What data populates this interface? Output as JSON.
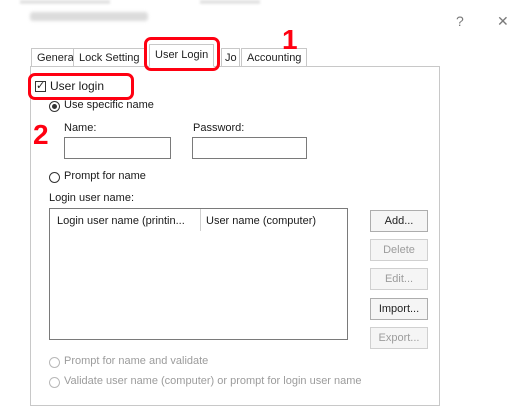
{
  "window": {
    "help_icon": "?",
    "close_icon": "✕"
  },
  "tabs": [
    {
      "label": "General"
    },
    {
      "label": "Lock Setting"
    },
    {
      "label": "User Login"
    },
    {
      "label": "Jo"
    },
    {
      "label": "Accounting"
    }
  ],
  "callouts": {
    "one": "1",
    "two": "2"
  },
  "user_login_checkbox": {
    "label": "User login",
    "checked": true
  },
  "use_specific_name": {
    "label": "Use specific name"
  },
  "name_label": "Name:",
  "password_label": "Password:",
  "prompt_for_name": {
    "label": "Prompt for name"
  },
  "login_user_name_label": "Login user name:",
  "list_columns": [
    "Login user name (printin...",
    "User name (computer)"
  ],
  "buttons": {
    "add": "Add...",
    "delete": "Delete",
    "edit": "Edit...",
    "import": "Import...",
    "export": "Export..."
  },
  "prompt_validate": {
    "label": "Prompt for name and validate"
  },
  "validate_user": {
    "label": "Validate user name (computer) or prompt for login user name"
  }
}
